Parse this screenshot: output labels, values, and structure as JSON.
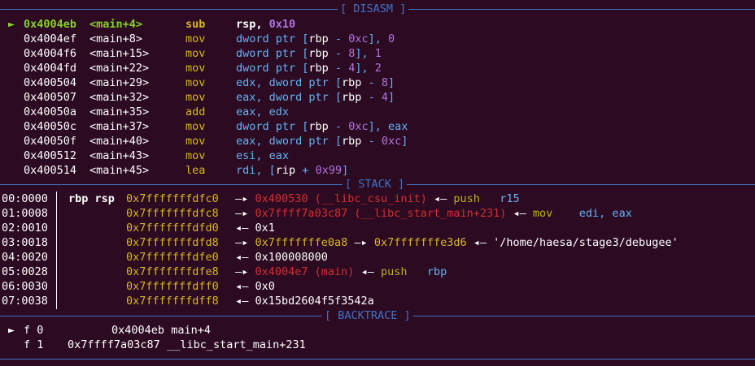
{
  "sections": {
    "disasm": "[ DISASM ]",
    "stack": "[ STACK ]",
    "backtrace": "[ BACKTRACE ]"
  },
  "disasm": {
    "current_marker": "►",
    "rows": [
      {
        "addr": "0x4004eb",
        "sym": "<main+4>",
        "mnem": "sub",
        "ops": [
          {
            "t": "rsp, ",
            "c": "white"
          },
          {
            "t": "0x10",
            "c": "purple"
          }
        ]
      },
      {
        "addr": "0x4004ef",
        "sym": "<main+8>",
        "mnem": "mov",
        "ops": [
          {
            "t": "dword ptr [",
            "c": "cyan"
          },
          {
            "t": "rbp",
            "c": "white"
          },
          {
            "t": " - ",
            "c": "cyan"
          },
          {
            "t": "0xc",
            "c": "purple"
          },
          {
            "t": "], ",
            "c": "cyan"
          },
          {
            "t": "0",
            "c": "purple"
          }
        ]
      },
      {
        "addr": "0x4004f6",
        "sym": "<main+15>",
        "mnem": "mov",
        "ops": [
          {
            "t": "dword ptr [",
            "c": "cyan"
          },
          {
            "t": "rbp",
            "c": "white"
          },
          {
            "t": " - ",
            "c": "cyan"
          },
          {
            "t": "8",
            "c": "purple"
          },
          {
            "t": "], ",
            "c": "cyan"
          },
          {
            "t": "1",
            "c": "purple"
          }
        ]
      },
      {
        "addr": "0x4004fd",
        "sym": "<main+22>",
        "mnem": "mov",
        "ops": [
          {
            "t": "dword ptr [",
            "c": "cyan"
          },
          {
            "t": "rbp",
            "c": "white"
          },
          {
            "t": " - ",
            "c": "cyan"
          },
          {
            "t": "4",
            "c": "purple"
          },
          {
            "t": "], ",
            "c": "cyan"
          },
          {
            "t": "2",
            "c": "purple"
          }
        ]
      },
      {
        "addr": "0x400504",
        "sym": "<main+29>",
        "mnem": "mov",
        "ops": [
          {
            "t": "edx, dword ptr [",
            "c": "cyan"
          },
          {
            "t": "rbp",
            "c": "white"
          },
          {
            "t": " - ",
            "c": "cyan"
          },
          {
            "t": "8",
            "c": "purple"
          },
          {
            "t": "]",
            "c": "cyan"
          }
        ]
      },
      {
        "addr": "0x400507",
        "sym": "<main+32>",
        "mnem": "mov",
        "ops": [
          {
            "t": "eax, dword ptr [",
            "c": "cyan"
          },
          {
            "t": "rbp",
            "c": "white"
          },
          {
            "t": " - ",
            "c": "cyan"
          },
          {
            "t": "4",
            "c": "purple"
          },
          {
            "t": "]",
            "c": "cyan"
          }
        ]
      },
      {
        "addr": "0x40050a",
        "sym": "<main+35>",
        "mnem": "add",
        "ops": [
          {
            "t": "eax, edx",
            "c": "cyan"
          }
        ]
      },
      {
        "addr": "0x40050c",
        "sym": "<main+37>",
        "mnem": "mov",
        "ops": [
          {
            "t": "dword ptr [",
            "c": "cyan"
          },
          {
            "t": "rbp",
            "c": "white"
          },
          {
            "t": " - ",
            "c": "cyan"
          },
          {
            "t": "0xc",
            "c": "purple"
          },
          {
            "t": "], eax",
            "c": "cyan"
          }
        ]
      },
      {
        "addr": "0x40050f",
        "sym": "<main+40>",
        "mnem": "mov",
        "ops": [
          {
            "t": "eax, dword ptr [",
            "c": "cyan"
          },
          {
            "t": "rbp",
            "c": "white"
          },
          {
            "t": " - ",
            "c": "cyan"
          },
          {
            "t": "0xc",
            "c": "purple"
          },
          {
            "t": "]",
            "c": "cyan"
          }
        ]
      },
      {
        "addr": "0x400512",
        "sym": "<main+43>",
        "mnem": "mov",
        "ops": [
          {
            "t": "esi, eax",
            "c": "cyan"
          }
        ]
      },
      {
        "addr": "0x400514",
        "sym": "<main+45>",
        "mnem": "lea",
        "ops": [
          {
            "t": "rdi, [",
            "c": "cyan"
          },
          {
            "t": "rip",
            "c": "white"
          },
          {
            "t": " + ",
            "c": "cyan"
          },
          {
            "t": "0x99",
            "c": "purple"
          },
          {
            "t": "]",
            "c": "cyan"
          }
        ]
      }
    ]
  },
  "stack": {
    "rows": [
      {
        "off": "00:0000",
        "regs": "rbp rsp",
        "addr": "0x7fffffffdfc0",
        "chain": [
          {
            "t": " —▸ ",
            "c": "white"
          },
          {
            "t": "0x400530 (__libc_csu_init)",
            "c": "red"
          },
          {
            "t": " ◂— ",
            "c": "white"
          },
          {
            "t": "push   ",
            "c": "olive"
          },
          {
            "t": "r15",
            "c": "cyan"
          }
        ]
      },
      {
        "off": "01:0008",
        "regs": "",
        "addr": "0x7fffffffdfc8",
        "chain": [
          {
            "t": " —▸ ",
            "c": "white"
          },
          {
            "t": "0x7ffff7a03c87 (__libc_start_main+231)",
            "c": "red"
          },
          {
            "t": " ◂— ",
            "c": "white"
          },
          {
            "t": "mov    ",
            "c": "olive"
          },
          {
            "t": "edi, eax",
            "c": "cyan"
          }
        ]
      },
      {
        "off": "02:0010",
        "regs": "",
        "addr": "0x7fffffffdfd0",
        "chain": [
          {
            "t": " ◂— ",
            "c": "white"
          },
          {
            "t": "0x1",
            "c": "white"
          }
        ]
      },
      {
        "off": "03:0018",
        "regs": "",
        "addr": "0x7fffffffdfd8",
        "chain": [
          {
            "t": " —▸ ",
            "c": "white"
          },
          {
            "t": "0x7fffffffe0a8",
            "c": "yellow"
          },
          {
            "t": " —▸ ",
            "c": "white"
          },
          {
            "t": "0x7fffffffe3d6",
            "c": "yellow"
          },
          {
            "t": " ◂— ",
            "c": "white"
          },
          {
            "t": "'/home/haesa/stage3/debugee'",
            "c": "white"
          }
        ]
      },
      {
        "off": "04:0020",
        "regs": "",
        "addr": "0x7fffffffdfe0",
        "chain": [
          {
            "t": " ◂— ",
            "c": "white"
          },
          {
            "t": "0x100008000",
            "c": "white"
          }
        ]
      },
      {
        "off": "05:0028",
        "regs": "",
        "addr": "0x7fffffffdfe8",
        "chain": [
          {
            "t": " —▸ ",
            "c": "white"
          },
          {
            "t": "0x4004e7 (main)",
            "c": "red"
          },
          {
            "t": " ◂— ",
            "c": "white"
          },
          {
            "t": "push   ",
            "c": "olive"
          },
          {
            "t": "rbp",
            "c": "cyan"
          }
        ]
      },
      {
        "off": "06:0030",
        "regs": "",
        "addr": "0x7fffffffdff0",
        "chain": [
          {
            "t": " ◂— ",
            "c": "white"
          },
          {
            "t": "0x0",
            "c": "white"
          }
        ]
      },
      {
        "off": "07:0038",
        "regs": "",
        "addr": "0x7fffffffdff8",
        "chain": [
          {
            "t": " ◂— ",
            "c": "white"
          },
          {
            "t": "0x15bd2604f5f3542a",
            "c": "white"
          }
        ]
      }
    ]
  },
  "backtrace": {
    "rows": [
      {
        "marker": "►",
        "frame": "f 0",
        "addr": "0x4004eb",
        "sym": "main+4"
      },
      {
        "marker": "",
        "frame": "f 1",
        "addr": "0x7ffff7a03c87",
        "sym": "__libc_start_main+231"
      }
    ]
  },
  "colors": {
    "background": "#2c0a22",
    "separator": "#3f73c5",
    "current": "#86d02c",
    "mnemonic": "#d6b822",
    "immediate": "#b075e0",
    "register": "#64b3f2",
    "code_pointer": "#d22f2f",
    "stack_pointer": "#d6b822"
  }
}
